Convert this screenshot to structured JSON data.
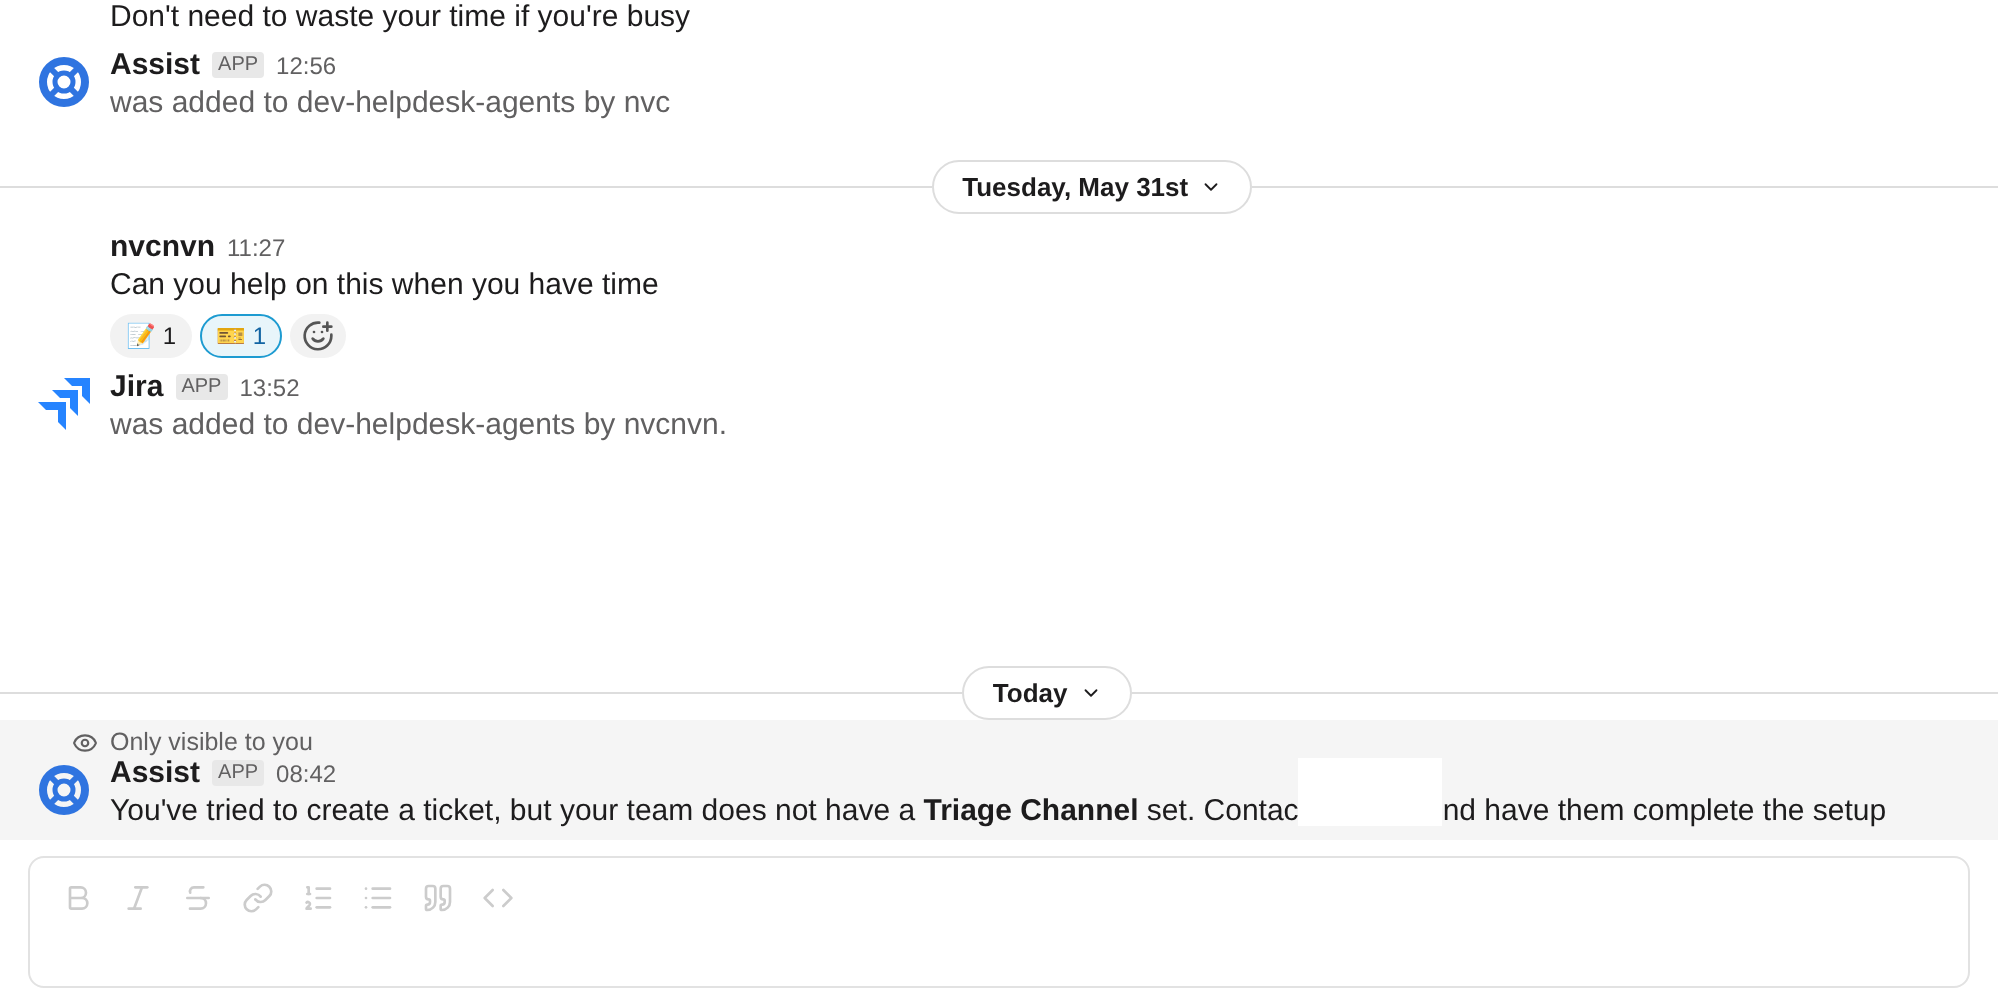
{
  "top_cut_text": "Don't need to waste your time if you're busy",
  "messages_before": [
    {
      "kind": "assist",
      "name": "Assist",
      "badge": "APP",
      "time": "12:56",
      "text": "was added to dev-helpdesk-agents by nvc"
    }
  ],
  "day_dividers": [
    {
      "label": "Tuesday, May 31st"
    },
    {
      "label": "Today"
    }
  ],
  "messages_day": [
    {
      "kind": "user",
      "name": "nvcnvn",
      "time": "11:27",
      "text": "Can you help on this when you have time",
      "reactions": [
        {
          "emoji": "📝",
          "count": "1",
          "selected": false
        },
        {
          "emoji": "🎫",
          "count": "1",
          "selected": true
        }
      ]
    },
    {
      "kind": "jira",
      "name": "Jira",
      "badge": "APP",
      "time": "13:52",
      "text": "was added to dev-helpdesk-agents by nvcnvn."
    }
  ],
  "ephemeral": {
    "notice": "Only visible to you",
    "name": "Assist",
    "badge": "APP",
    "time": "08:42",
    "text_before": "You've tried to create a ticket, but your team does not have a **Triage Channel** set. Contac",
    "text_after": "nd have them complete the setup"
  }
}
